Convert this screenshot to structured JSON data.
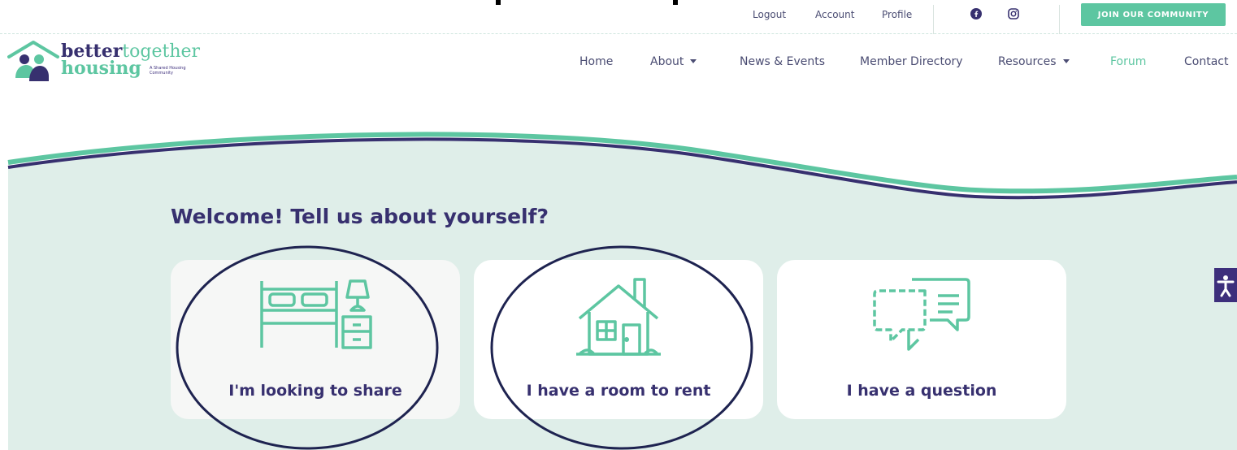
{
  "top_bar": {
    "logout": "Logout",
    "account": "Account",
    "profile": "Profile",
    "join_button": "JOIN OUR COMMUNITY",
    "icons": [
      "facebook-icon",
      "instagram-icon"
    ]
  },
  "logo": {
    "word_better": "better",
    "word_together": "together",
    "word_housing": "housing",
    "tagline": "A Shared Housing Community"
  },
  "nav": {
    "items": [
      {
        "label": "Home"
      },
      {
        "label": "About"
      },
      {
        "label": "News & Events"
      },
      {
        "label": "Member Directory"
      },
      {
        "label": "Resources"
      },
      {
        "label": "Forum"
      },
      {
        "label": "Contact"
      }
    ],
    "active": "Forum"
  },
  "hero": {
    "heading": "Welcome! Tell us about yourself?"
  },
  "cards": [
    {
      "label": "I'm looking to share",
      "icon": "bed-icon"
    },
    {
      "label": "I have a room to rent",
      "icon": "house-icon"
    },
    {
      "label": "I have a question",
      "icon": "chat-bubbles-icon"
    }
  ],
  "accessibility": {
    "icon": "accessibility-icon"
  },
  "colors": {
    "accent_green": "#5dc6a1",
    "navy": "#37306f",
    "purple": "#3d2f7c",
    "hero_bg": "#dfeee9",
    "card_bg": "#ffffff",
    "card_bg_first": "#f6f7f6"
  }
}
